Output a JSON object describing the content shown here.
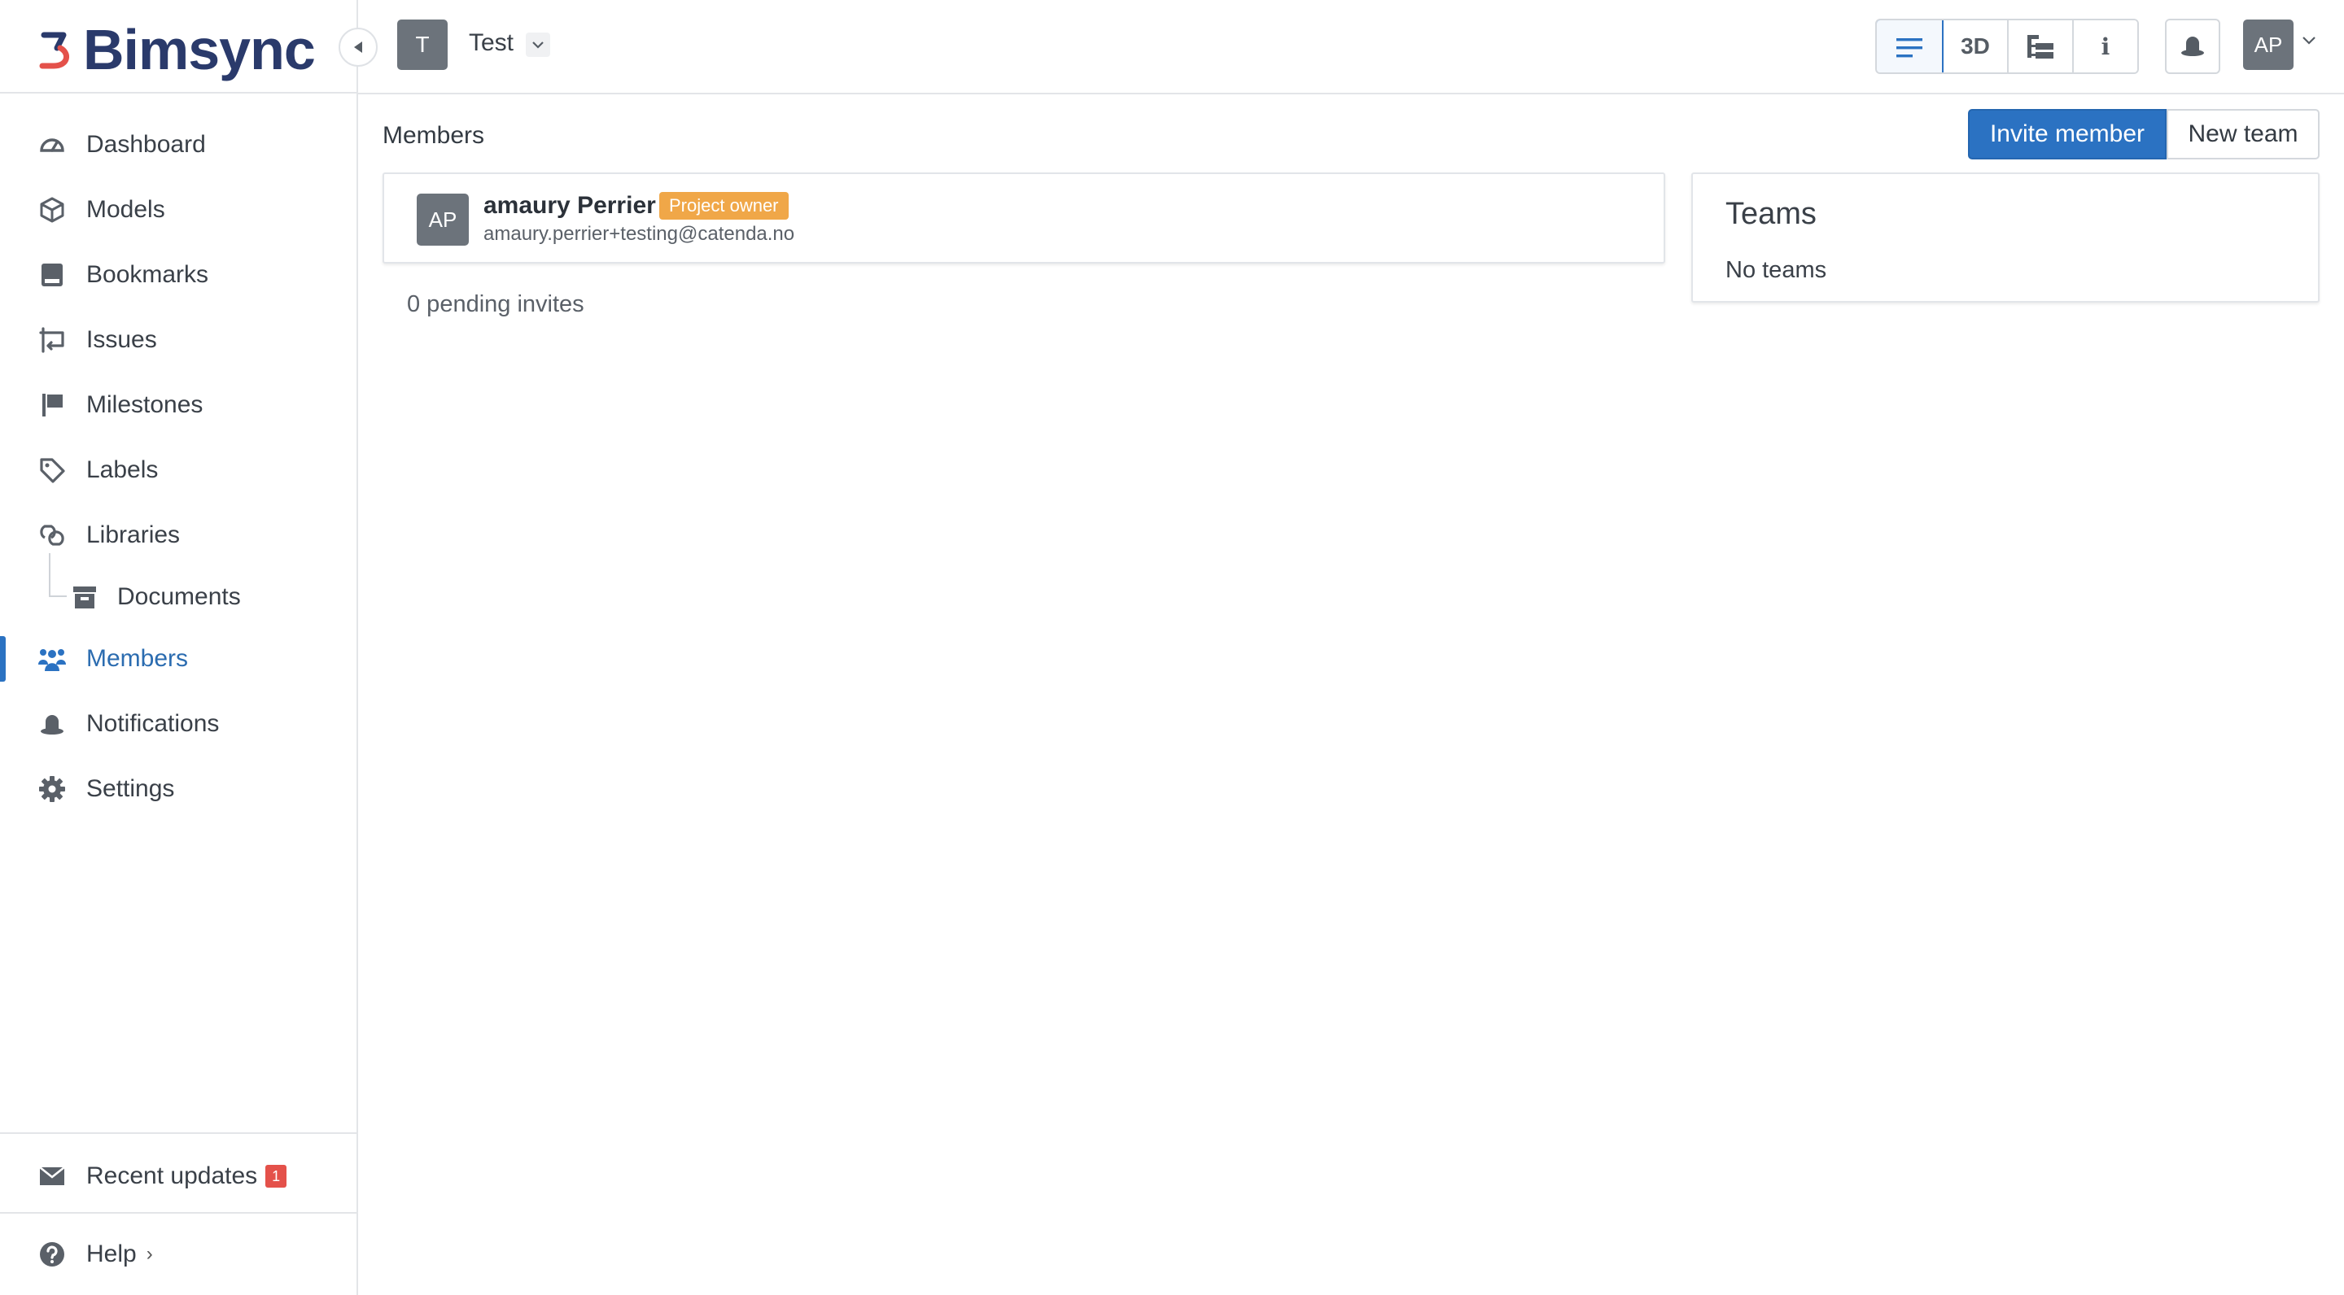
{
  "app": {
    "logo_text": "Bimsync"
  },
  "header": {
    "project_initial": "T",
    "project_name": "Test",
    "view_buttons": [
      {
        "name": "list-view",
        "label": ""
      },
      {
        "name": "3d-view",
        "label": "3D"
      },
      {
        "name": "tree-view",
        "label": ""
      },
      {
        "name": "info-view",
        "label": "i"
      }
    ],
    "user_initials": "AP"
  },
  "sidebar": {
    "items": [
      {
        "label": "Dashboard",
        "icon": "dashboard-icon"
      },
      {
        "label": "Models",
        "icon": "cube-icon"
      },
      {
        "label": "Bookmarks",
        "icon": "bookmark-icon"
      },
      {
        "label": "Issues",
        "icon": "issues-icon"
      },
      {
        "label": "Milestones",
        "icon": "flag-icon"
      },
      {
        "label": "Labels",
        "icon": "tag-icon"
      },
      {
        "label": "Libraries",
        "icon": "libraries-icon"
      },
      {
        "label": "Documents",
        "icon": "archive-icon"
      },
      {
        "label": "Members",
        "icon": "members-icon",
        "active": true
      },
      {
        "label": "Notifications",
        "icon": "bell-icon"
      },
      {
        "label": "Settings",
        "icon": "gear-icon"
      }
    ],
    "recent_updates": {
      "label": "Recent updates",
      "count": "1"
    },
    "help": {
      "label": "Help"
    }
  },
  "main": {
    "title": "Members",
    "invite_button": "Invite member",
    "new_team_button": "New team",
    "members": [
      {
        "initials": "AP",
        "name": "amaury Perrier",
        "role_badge": "Project owner",
        "email": "amaury.perrier+testing@catenda.no"
      }
    ],
    "pending_invites": "0 pending invites",
    "teams": {
      "title": "Teams",
      "empty_text": "No teams"
    }
  },
  "colors": {
    "accent": "#2b72c2",
    "badge_owner": "#f0a748",
    "badge_count": "#e4514a",
    "avatar_bg": "#6c737b",
    "logo": "#2a3a6b"
  }
}
